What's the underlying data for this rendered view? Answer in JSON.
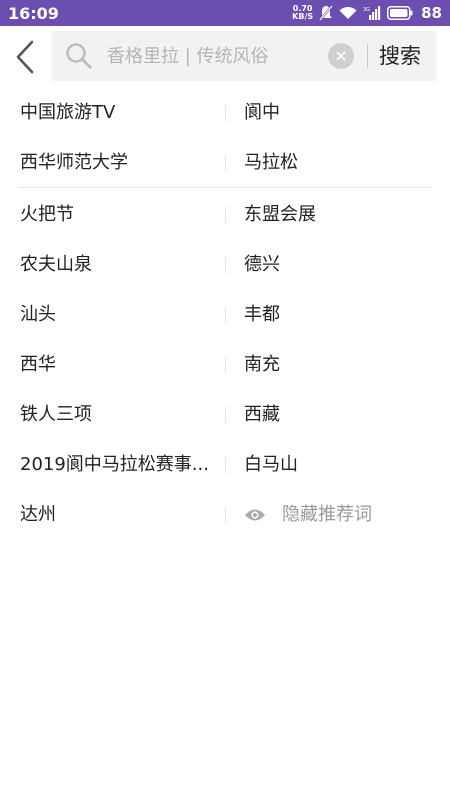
{
  "status_bar": {
    "time": "16:09",
    "net_speed_value": "0.70",
    "net_speed_unit": "KB/S",
    "signal_label": "3G",
    "battery": "88"
  },
  "search": {
    "placeholder": "香格里拉 | 传统风俗",
    "value": "",
    "button_label": "搜索"
  },
  "suggestions": {
    "rows": [
      {
        "left": "中国旅游TV",
        "right": "阆中"
      },
      {
        "left": "西华师范大学",
        "right": "马拉松"
      },
      {
        "left": "火把节",
        "right": "东盟会展"
      },
      {
        "left": "农夫山泉",
        "right": "德兴"
      },
      {
        "left": "汕头",
        "right": "丰都"
      },
      {
        "left": "西华",
        "right": "南充"
      },
      {
        "left": "铁人三项",
        "right": "西藏"
      },
      {
        "left": "2019阆中马拉松赛事...",
        "right": "白马山"
      },
      {
        "left": "达州"
      }
    ],
    "hide_label": "隐藏推荐词"
  },
  "colors": {
    "status_bar": "#6a4fb0",
    "search_bg": "#f2f2f2",
    "muted_text": "#999999"
  }
}
